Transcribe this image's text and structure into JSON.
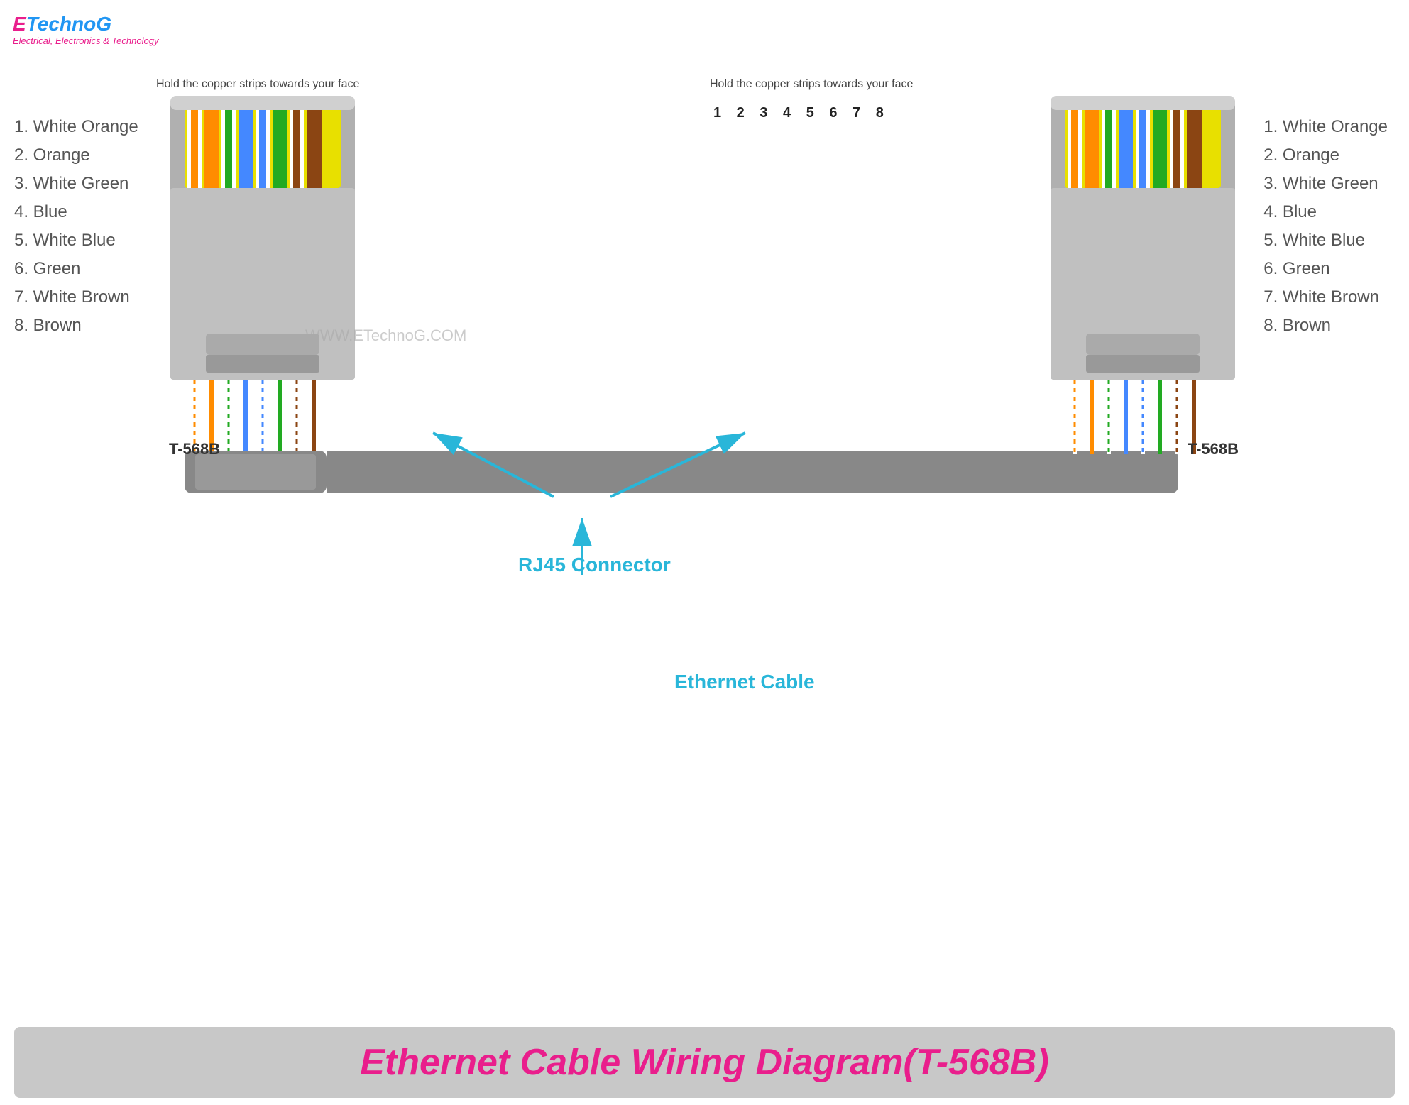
{
  "logo": {
    "e": "E",
    "technog": "TechnoG",
    "subtitle": "Electrical, Electronics & Technology"
  },
  "instruction": "Hold the copper strips towards your face",
  "pin_numbers": "1 2 3 4 5 6 7 8",
  "watermark": "WWW.ETechnoG.COM",
  "label_t568b": "T-568B",
  "label_rj45": "RJ45 Connector",
  "label_ethernet": "Ethernet Cable",
  "footer_title": "Ethernet Cable Wiring Diagram(T-568B)",
  "pins_left": [
    "1. White Orange",
    "2. Orange",
    "3. White Green",
    "4. Blue",
    "5. White Blue",
    "6. Green",
    "7. White Brown",
    "8. Brown"
  ],
  "pins_right": [
    "1. White Orange",
    "2. Orange",
    "3. White Green",
    "4. Blue",
    "5. White Blue",
    "6. Green",
    "7. White Brown",
    "8. Brown"
  ]
}
